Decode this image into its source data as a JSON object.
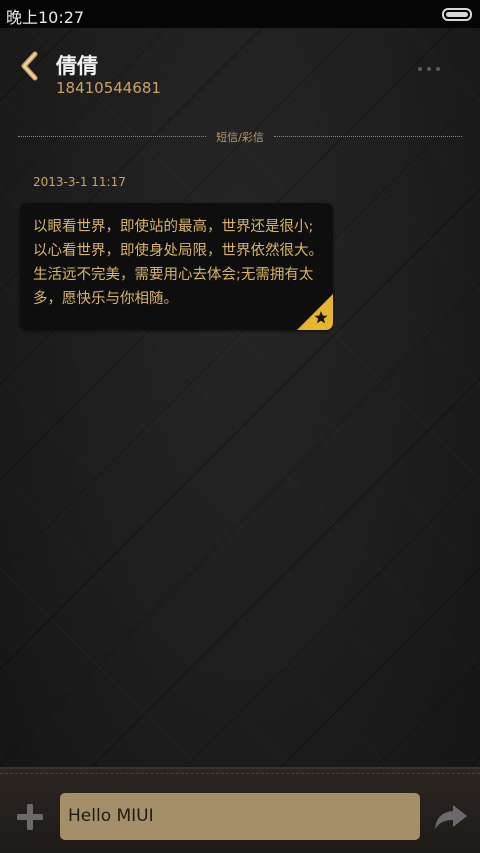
{
  "status_bar": {
    "time": "晚上10:27",
    "battery_icon": "battery-icon"
  },
  "header": {
    "back_icon": "chevron-left-icon",
    "contact_name": "倩倩",
    "contact_number": "18410544681",
    "more_icon": "more-dots-icon"
  },
  "divider": {
    "label": "短信/彩信"
  },
  "messages": [
    {
      "timestamp": "2013-3-1 11:17",
      "text": "以眼看世界，即使站的最高，世界还是很小;以心看世界，即使身处局限，世界依然很大。生活远不完美，需要用心去体会;无需拥有太多，愿快乐与你相随。",
      "starred": true,
      "star_icon": "star-icon"
    }
  ],
  "compose": {
    "add_icon": "plus-icon",
    "input_value": "Hello MIUI",
    "send_icon": "send-arrow-icon"
  },
  "colors": {
    "accent_gold": "#c9a465",
    "bubble_text": "#d7b46c",
    "star_badge": "#e8b530",
    "input_background": "#a58f6a"
  }
}
